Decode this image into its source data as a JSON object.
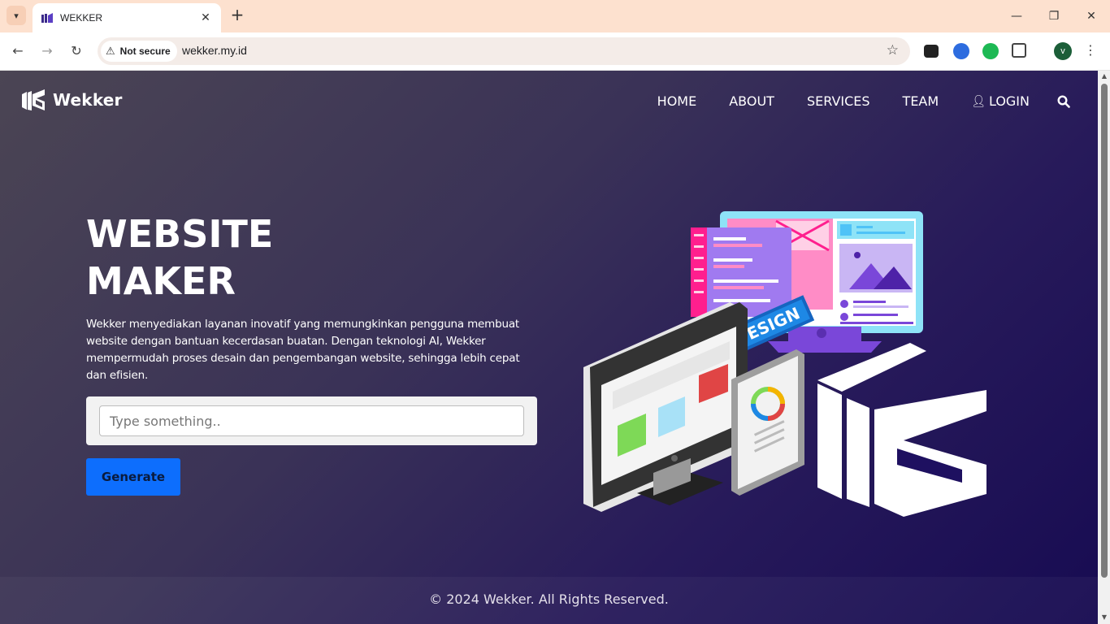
{
  "browser": {
    "tab_title": "WEKKER",
    "security_label": "Not secure",
    "url": "wekker.my.id",
    "profile_initial": "v"
  },
  "site": {
    "logo_text": "Wekker",
    "nav": {
      "home": "HOME",
      "about": "ABOUT",
      "services": "SERVICES",
      "team": "TEAM",
      "login": "LOGIN"
    },
    "hero": {
      "title_line1": "WEBSITE",
      "title_line2": "MAKER",
      "description": "Wekker menyediakan layanan inovatif yang memungkinkan pengguna membuat website dengan bantuan kecerdasan buatan. Dengan teknologi AI, Wekker mempermudah proses desain dan pengembangan website, sehingga lebih cepat dan efisien.",
      "input_placeholder": "Type something..",
      "generate_label": "Generate",
      "design_badge": "DESIGN"
    },
    "footer_text": "© 2024 Wekker. All Rights Reserved."
  },
  "colors": {
    "primary_button": "#0d6efd",
    "accent_purple": "#7c4dd6",
    "accent_pink": "#ff1f8e"
  }
}
